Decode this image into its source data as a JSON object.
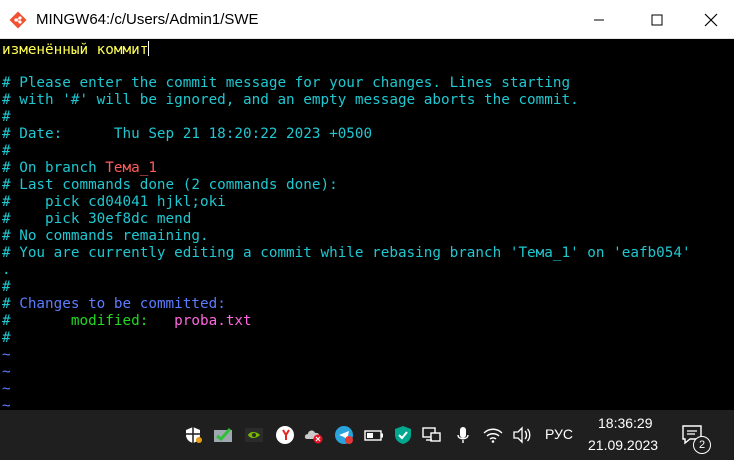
{
  "window": {
    "title": "MINGW64:/c/Users/Admin1/SWE",
    "icon": "git-bash-icon"
  },
  "terminal": {
    "lines": [
      {
        "segments": [
          {
            "text": "изменённый коммит",
            "color": "yellow"
          }
        ],
        "cursor": true
      },
      {
        "segments": [
          {
            "text": "",
            "color": "cyan"
          }
        ]
      },
      {
        "segments": [
          {
            "text": "# Please enter the commit message for your changes. Lines starting",
            "color": "cyan"
          }
        ]
      },
      {
        "segments": [
          {
            "text": "# with '#' will be ignored, and an empty message aborts the commit.",
            "color": "cyan"
          }
        ]
      },
      {
        "segments": [
          {
            "text": "#",
            "color": "cyan"
          }
        ]
      },
      {
        "segments": [
          {
            "text": "# Date:      Thu Sep 21 18:20:22 2023 +0500",
            "color": "cyan"
          }
        ]
      },
      {
        "segments": [
          {
            "text": "#",
            "color": "cyan"
          }
        ]
      },
      {
        "segments": [
          {
            "text": "# On branch ",
            "color": "cyan"
          },
          {
            "text": "Тема_1",
            "color": "orange"
          }
        ]
      },
      {
        "segments": [
          {
            "text": "# Last commands done (2 commands done):",
            "color": "cyan"
          }
        ]
      },
      {
        "segments": [
          {
            "text": "#    pick cd04041 hjkl;oki",
            "color": "cyan"
          }
        ]
      },
      {
        "segments": [
          {
            "text": "#    pick 30ef8dc mend",
            "color": "cyan"
          }
        ]
      },
      {
        "segments": [
          {
            "text": "# No commands remaining.",
            "color": "cyan"
          }
        ]
      },
      {
        "segments": [
          {
            "text": "# You are currently editing a commit while rebasing branch 'Тема_1' on 'eafb054'",
            "color": "cyan"
          }
        ]
      },
      {
        "segments": [
          {
            "text": ".",
            "color": "cyan"
          }
        ]
      },
      {
        "segments": [
          {
            "text": "#",
            "color": "cyan"
          }
        ]
      },
      {
        "segments": [
          {
            "text": "# ",
            "color": "cyan"
          },
          {
            "text": "Changes to be committed:",
            "color": "blue"
          }
        ]
      },
      {
        "segments": [
          {
            "text": "#       ",
            "color": "cyan"
          },
          {
            "text": "modified:   ",
            "color": "green"
          },
          {
            "text": "proba.txt",
            "color": "pink"
          }
        ]
      },
      {
        "segments": [
          {
            "text": "#",
            "color": "cyan"
          }
        ]
      },
      {
        "segments": [
          {
            "text": "~",
            "color": "blue"
          }
        ]
      },
      {
        "segments": [
          {
            "text": "~",
            "color": "blue"
          }
        ]
      },
      {
        "segments": [
          {
            "text": "~",
            "color": "blue"
          }
        ]
      },
      {
        "segments": [
          {
            "text": "~",
            "color": "blue"
          }
        ]
      }
    ],
    "colors": {
      "yellow": "#ffff55",
      "cyan": "#1fc7d1",
      "blue": "#5c7cff",
      "orange": "#ff5c5c",
      "green": "#22d822",
      "pink": "#ff66e0"
    }
  },
  "taskbar": {
    "tray_icons": [
      "security-shield-icon",
      "checkmark-app-icon",
      "nvidia-icon",
      "yandex-icon",
      "cloud-error-icon",
      "telegram-icon",
      "battery-icon",
      "kaspersky-icon",
      "network-computer-icon",
      "microphone-icon",
      "wifi-icon",
      "volume-icon"
    ],
    "language": "РУС",
    "time": "18:36:29",
    "date": "21.09.2023",
    "notification_count": "2"
  }
}
